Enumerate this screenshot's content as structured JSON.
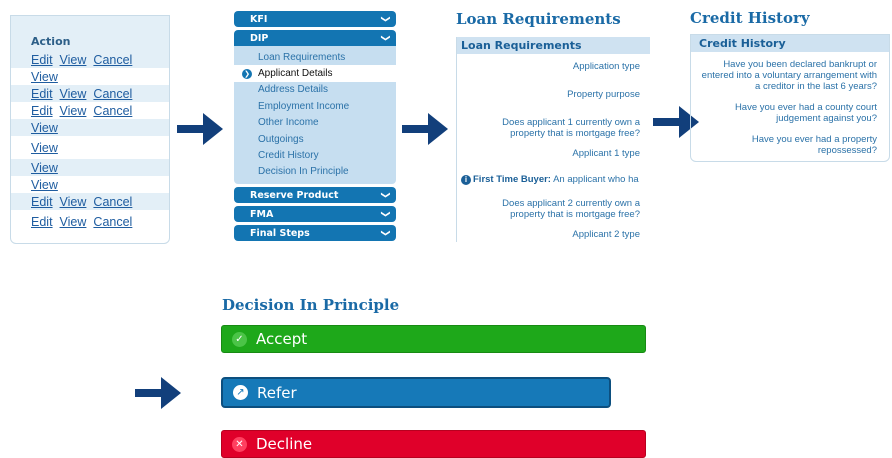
{
  "colors": {
    "arrow": "#123f7b",
    "accent": "#1375b2",
    "accept": "#1ea81a",
    "refer": "#1679b8",
    "decline": "#e0002a"
  },
  "actions": {
    "header": "Action",
    "rows": [
      [
        "Edit",
        "View",
        "Cancel"
      ],
      [
        "View"
      ],
      [
        "Edit",
        "View",
        "Cancel"
      ],
      [
        "Edit",
        "View",
        "Cancel"
      ],
      [
        "View"
      ],
      [
        "View"
      ],
      [
        "View"
      ],
      [
        "View"
      ],
      [
        "Edit",
        "View",
        "Cancel"
      ],
      [
        "Edit",
        "View",
        "Cancel"
      ]
    ]
  },
  "nav": {
    "sections": [
      {
        "label": "KFI",
        "open": false
      },
      {
        "label": "DIP",
        "open": true,
        "items": [
          "Loan Requirements",
          "Applicant Details",
          "Address Details",
          "Employment Income",
          "Other Income",
          "Outgoings",
          "Credit History",
          "Decision In Principle"
        ],
        "active_index": 1
      },
      {
        "label": "Reserve Product",
        "open": false
      },
      {
        "label": "FMA",
        "open": false
      },
      {
        "label": "Final Steps",
        "open": false
      }
    ]
  },
  "loan": {
    "title": "Loan Requirements",
    "panel_header": "Loan Requirements",
    "q1": "Application type",
    "q2": "Property purpose",
    "q3": "Does applicant 1 currently own a property that is mortgage free?",
    "q4": "Applicant 1 type",
    "ftb_label": "First Time Buyer:",
    "ftb_text": "An applicant who ha",
    "q5": "Does applicant 2 currently own a property that is mortgage free?",
    "q6": "Applicant 2 type"
  },
  "credit": {
    "title": "Credit History",
    "panel_header": "Credit History",
    "q1": "Have you been declared bankrupt or entered into a voluntary arrangement with a creditor in the last 6 years?",
    "q2": "Have you ever had a county court judgement against you?",
    "q3": "Have you ever had a property repossessed?"
  },
  "dip": {
    "title": "Decision In Principle",
    "accept": "Accept",
    "refer": "Refer",
    "decline": "Decline",
    "accept_icon": "✓",
    "refer_icon": "↗",
    "decline_icon": "✕"
  }
}
